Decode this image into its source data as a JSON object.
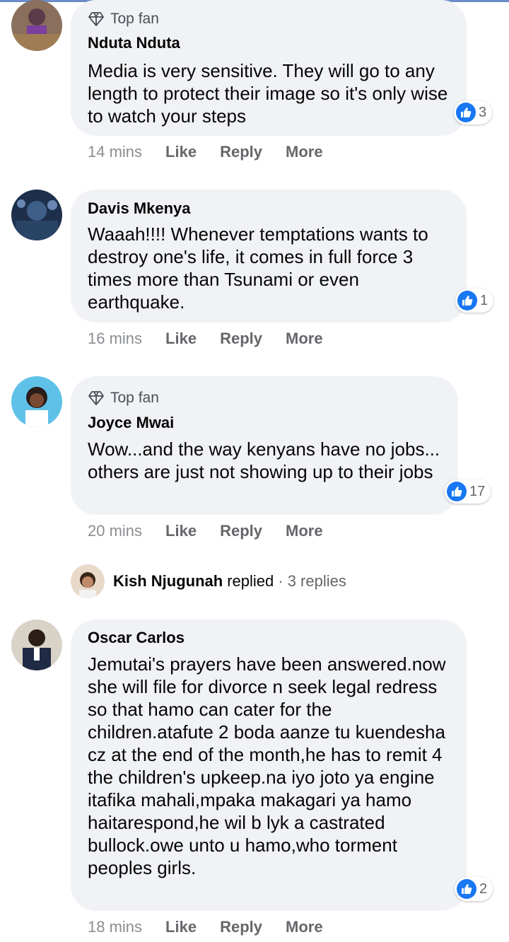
{
  "comments": [
    {
      "badge": "Top fan",
      "name": "Nduta Nduta",
      "text": "Media is very sensitive. They will go to any length to protect their image so it's only wise to watch your steps",
      "reactions": "3",
      "time": "14 mins",
      "like": "Like",
      "reply": "Reply",
      "more": "More"
    },
    {
      "name": "Davis Mkenya",
      "text": "Waaah!!!! Whenever temptations wants to destroy one's life, it comes in full force 3 times more than Tsunami or even earthquake.",
      "reactions": "1",
      "time": "16 mins",
      "like": "Like",
      "reply": "Reply",
      "more": "More"
    },
    {
      "badge": "Top fan",
      "name": "Joyce Mwai",
      "text": "Wow...and the way kenyans have no jobs... others are just not showing up to their jobs",
      "reactions": "17",
      "time": "20 mins",
      "like": "Like",
      "reply": "Reply",
      "more": "More"
    },
    {
      "name": "Oscar Carlos",
      "text": "Jemutai's prayers have been answered.now she will file for divorce n seek legal redress so that hamo can cater for the children.atafute 2 boda aanze tu kuendesha cz at the end of the month,he has to remit 4 the children's upkeep.na iyo joto ya engine itafika mahali,mpaka makagari ya hamo haitarespond,he wil b lyk a castrated bullock.owe unto u hamo,who torment peoples girls.",
      "reactions": "2",
      "time": "18 mins",
      "like": "Like",
      "reply": "Reply",
      "more": "More"
    }
  ],
  "reply_summary": {
    "name": "Kish Njugunah",
    "verb": "replied",
    "count": "· 3 replies"
  },
  "colors": {
    "bubble": "#f0f2f5",
    "like_blue": "#1877f2",
    "secondary_text": "#65676b"
  },
  "icons": [
    "diamond-icon",
    "thumbs-up-icon"
  ]
}
